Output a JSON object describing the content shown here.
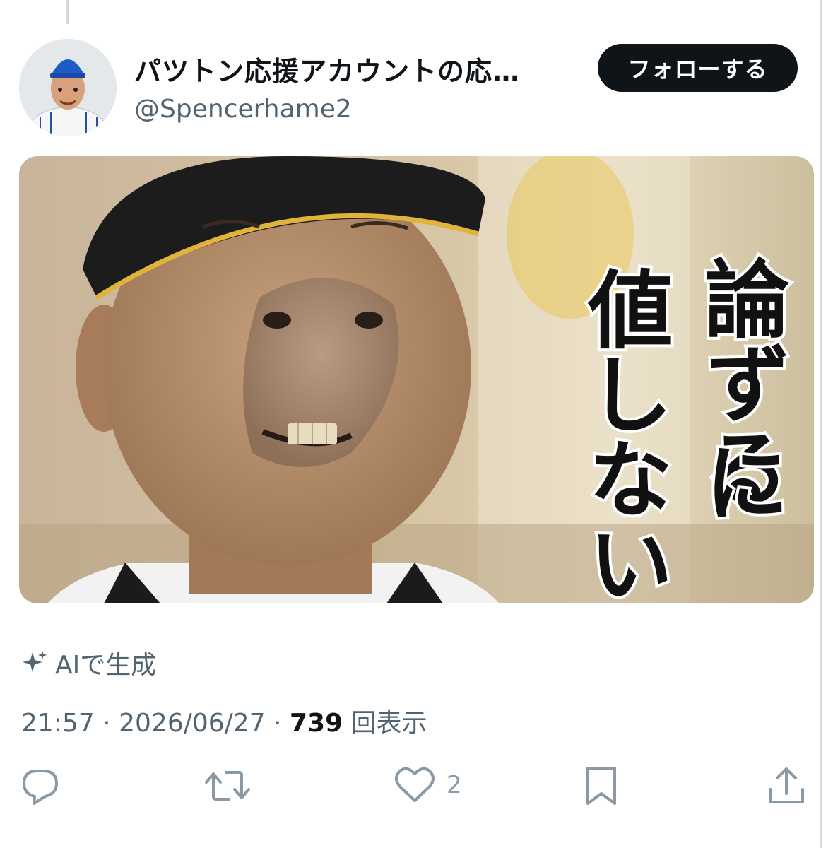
{
  "tweet": {
    "display_name": "パツトン応援アカウントの応…",
    "handle": "@Spencerhame2",
    "follow_label": "フォローする",
    "media": {
      "caption_line1": "論ずる",
      "caption_line2": "に",
      "caption_line3": "値しない"
    },
    "ai_label": "AIで生成",
    "time": "21:57",
    "date": "2026/06/27",
    "views_count": "739",
    "views_label": "回表示",
    "separator": "·"
  },
  "actions": {
    "reply_count": "",
    "retweet_count": "",
    "like_count": "2",
    "bookmark_count": ""
  },
  "colors": {
    "text_primary": "#0f1419",
    "text_secondary": "#536471",
    "icon_gray": "#8b98a5",
    "follow_bg": "#0f1419"
  }
}
